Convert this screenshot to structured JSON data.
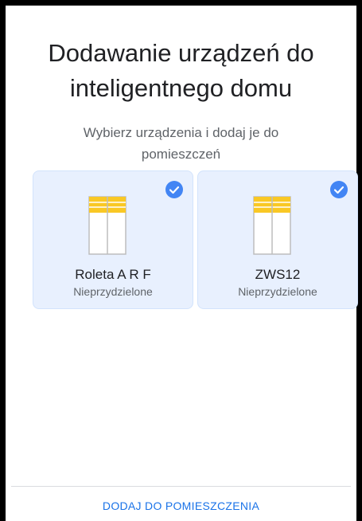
{
  "header": {
    "title": "Dodawanie urządzeń do inteligentnego domu",
    "subtitle": "Wybierz urządzenia i dodaj je do pomieszczeń"
  },
  "devices": [
    {
      "name": "Roleta A R F",
      "status": "Nieprzydzielone",
      "selected": true,
      "icon": "window-blind-icon"
    },
    {
      "name": "ZWS12",
      "status": "Nieprzydzielone",
      "selected": true,
      "icon": "window-blind-icon"
    }
  ],
  "footer": {
    "action_label": "DODAJ DO POMIESZCZENIA"
  },
  "colors": {
    "accent": "#1a73e8",
    "card_bg": "#e8f0fe",
    "check_bg": "#4285f4",
    "blind_yellow": "#f9c825"
  }
}
